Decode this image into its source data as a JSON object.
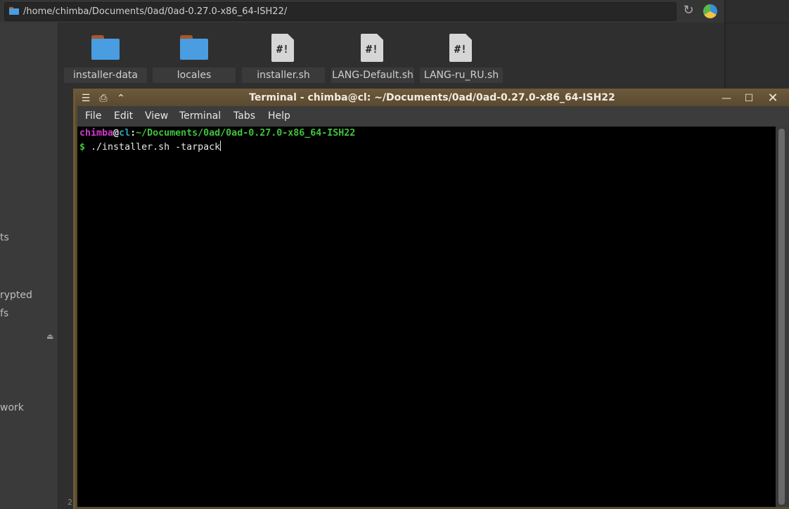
{
  "file_manager": {
    "address": "/home/chimba/Documents/0ad/0ad-0.27.0-x86_64-ISH22/",
    "sidebar_labels": [
      "ts",
      "rypted",
      "fs",
      "work"
    ],
    "status_fragment": "2",
    "files": [
      {
        "name": "installer-data",
        "icon": "folder-icon"
      },
      {
        "name": "locales",
        "icon": "folder-icon"
      },
      {
        "name": "installer.sh",
        "icon": "script-icon"
      },
      {
        "name": "LANG-Default.sh",
        "icon": "script-icon"
      },
      {
        "name": "LANG-ru_RU.sh",
        "icon": "script-icon"
      }
    ],
    "script_glyph": "#!"
  },
  "terminal": {
    "title": "Terminal - chimba@cl: ~/Documents/0ad/0ad-0.27.0-x86_64-ISH22",
    "menu": [
      "File",
      "Edit",
      "View",
      "Terminal",
      "Tabs",
      "Help"
    ],
    "prompt": {
      "user": "chimba",
      "at": "@",
      "host": "cl",
      "sep": ":",
      "path": "~/Documents/0ad/0ad-0.27.0-x86_64-ISH22",
      "dollar": "$",
      "command": "./installer.sh -tarpack"
    },
    "colors": {
      "user": "#d03bc9",
      "host": "#2aa8b8",
      "path": "#3fc43b",
      "title_bar": "#5a4a30"
    }
  }
}
